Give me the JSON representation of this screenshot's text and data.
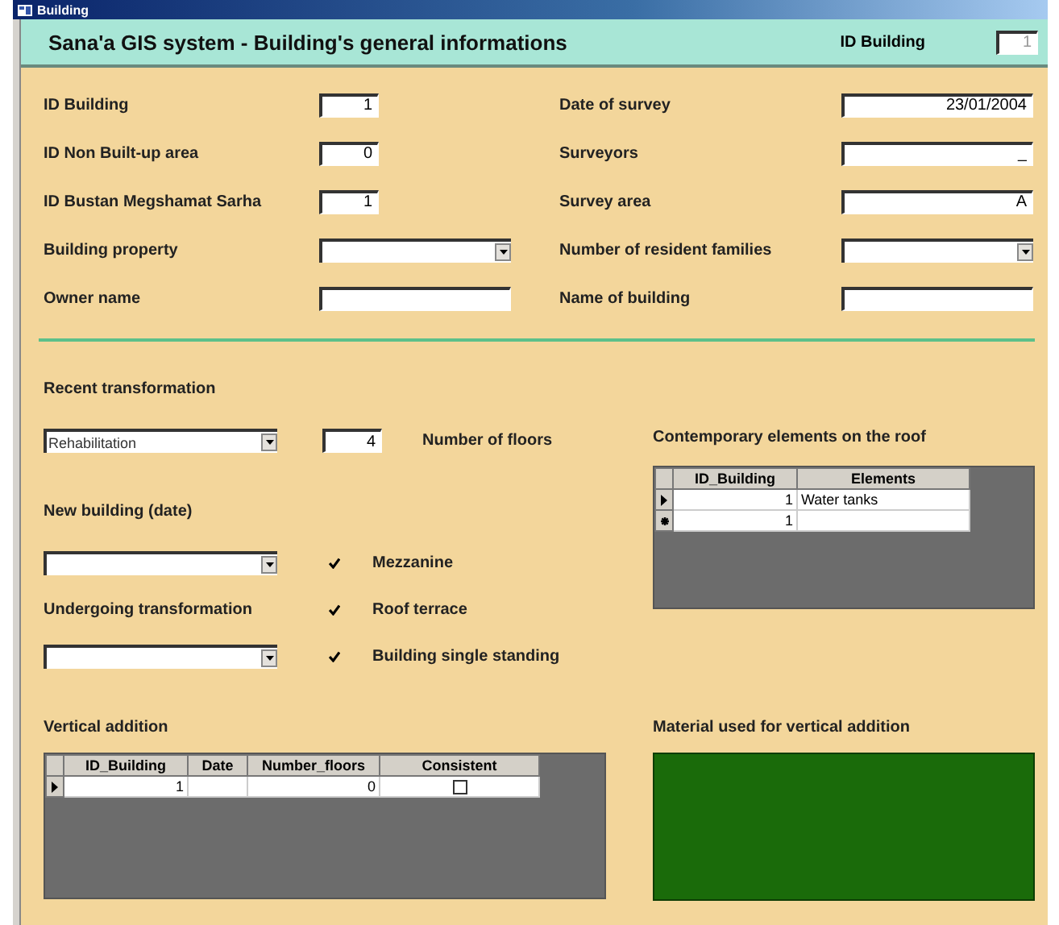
{
  "window": {
    "title": "Building"
  },
  "header": {
    "title": "Sana'a GIS system - Building's general informations",
    "id_label": "ID Building",
    "id_value": "1"
  },
  "fields_left": [
    {
      "label": "ID Building",
      "kind": "short",
      "value": "1"
    },
    {
      "label": "ID Non Built-up area",
      "kind": "short",
      "value": "0"
    },
    {
      "label": "ID Bustan Megshamat Sarha",
      "kind": "short",
      "value": "1"
    },
    {
      "label": "Building property",
      "kind": "combo"
    },
    {
      "label": "Owner name",
      "kind": "text"
    }
  ],
  "fields_right": [
    {
      "label": "Date of survey",
      "kind": "text",
      "value": "23/01/2004"
    },
    {
      "label": "Surveyors",
      "kind": "text",
      "value": "_"
    },
    {
      "label": "Survey area",
      "kind": "text",
      "value": "A"
    },
    {
      "label": "Number of resident families",
      "kind": "combo"
    },
    {
      "label": "Name of building",
      "kind": "text"
    }
  ],
  "recent_transformation": {
    "label": "Recent transformation",
    "value": "Rehabilitation"
  },
  "floors": {
    "value": "4",
    "label": "Number of floors"
  },
  "new_building": {
    "label": "New building (date)"
  },
  "undergoing": {
    "label": "Undergoing transformation"
  },
  "checkboxes": [
    {
      "label": "Mezzanine",
      "checked": true
    },
    {
      "label": "Roof terrace",
      "checked": true
    },
    {
      "label": "Building single standing",
      "checked": true
    }
  ],
  "roof": {
    "title": "Contemporary elements on the roof",
    "columns": [
      "ID_Building",
      "Elements"
    ],
    "rows": [
      {
        "kind": "current",
        "cells": [
          "1",
          "Water tanks"
        ]
      },
      {
        "kind": "new",
        "cells": [
          "1"
        ]
      }
    ]
  },
  "vertical": {
    "title": "Vertical addition",
    "columns": [
      "ID_Building",
      "Date",
      "Number_floors",
      "Consistent"
    ],
    "rows": [
      {
        "kind": "current",
        "id": "1",
        "floors": "0",
        "consistent": false
      }
    ]
  },
  "material": {
    "title": "Material used for vertical addition"
  }
}
